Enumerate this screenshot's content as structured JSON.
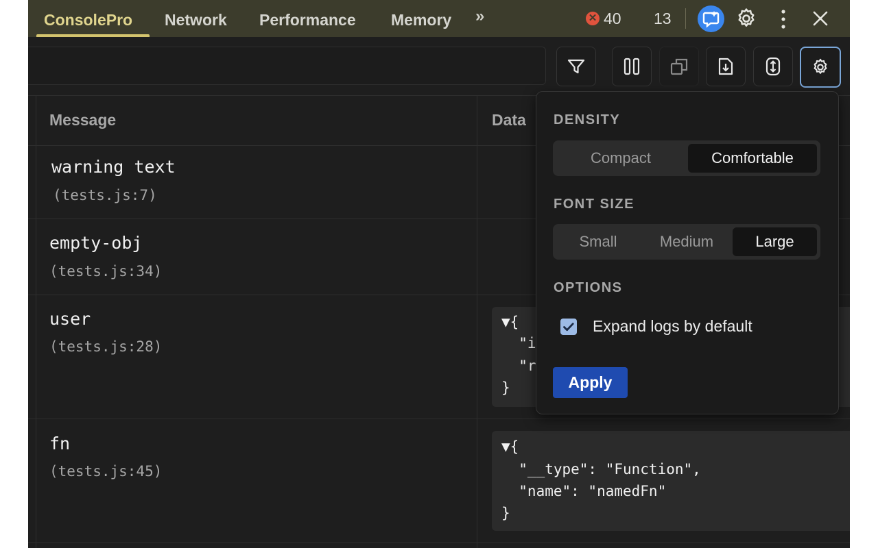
{
  "tabs": [
    {
      "label": "ConsolePro",
      "active": true
    },
    {
      "label": "Network",
      "active": false
    },
    {
      "label": "Performance",
      "active": false
    },
    {
      "label": "Memory",
      "active": false
    }
  ],
  "more_tabs_icon": "»",
  "status": {
    "errors": "40",
    "warnings": "13",
    "error_color": "#e0533d",
    "warning_color": "#e07a3d"
  },
  "icons": {
    "top_bar": [
      "ai-assistant-icon",
      "gear-icon",
      "kebab-menu-icon",
      "close-icon"
    ],
    "toolbar": [
      "filter-icon",
      "pause-icon",
      "copy-icon",
      "download-icon",
      "expand-vertical-icon",
      "settings-icon"
    ]
  },
  "table": {
    "columns": [
      "Message",
      "Data"
    ],
    "rows": [
      {
        "message": "warning text",
        "source": "(tests.js:7)",
        "data": []
      },
      {
        "message": "empty-obj",
        "source": "(tests.js:34)",
        "data": []
      },
      {
        "message": "user",
        "source": "(tests.js:28)",
        "data": [
          "▼{",
          "  \"i",
          "  \"r",
          "}"
        ]
      },
      {
        "message": "fn",
        "source": "(tests.js:45)",
        "data": [
          "▼{",
          "  \"__type\": \"Function\",",
          "  \"name\": \"namedFn\"",
          "}"
        ]
      }
    ]
  },
  "settings": {
    "density": {
      "title": "DENSITY",
      "options": [
        "Compact",
        "Comfortable"
      ],
      "selected": "Comfortable"
    },
    "font_size": {
      "title": "FONT SIZE",
      "options": [
        "Small",
        "Medium",
        "Large"
      ],
      "selected": "Large"
    },
    "options": {
      "title": "OPTIONS",
      "expand_logs_label": "Expand logs by default",
      "expand_logs_checked": true
    },
    "apply_label": "Apply"
  }
}
